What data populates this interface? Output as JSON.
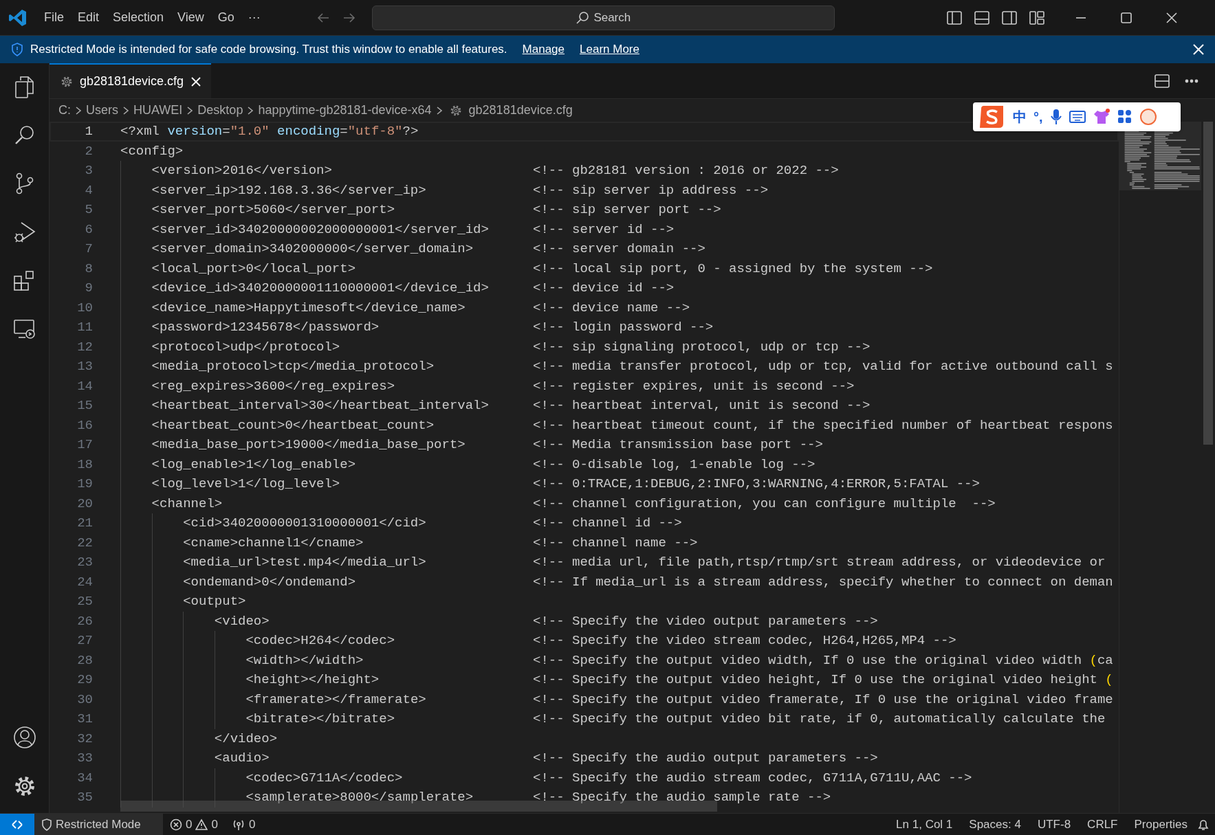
{
  "title_bar": {
    "menus": [
      "File",
      "Edit",
      "Selection",
      "View",
      "Go",
      "···"
    ],
    "search": {
      "placeholder": "Search"
    }
  },
  "banner": {
    "message": "Restricted Mode is intended for safe code browsing. Trust this window to enable all features.",
    "links": [
      "Manage",
      "Learn More"
    ]
  },
  "tabs": [
    {
      "label": "gb28181device.cfg",
      "selected": true
    }
  ],
  "breadcrumbs": [
    "C:",
    "Users",
    "HUAWEI",
    "Desktop",
    "happytime-gb28181-device-x64",
    "gb28181device.cfg"
  ],
  "ime_toolbar": {
    "labels": [
      "中",
      "°,"
    ]
  },
  "editor": {
    "lines": [
      {
        "number": "1",
        "current": true,
        "code": [
          {
            "text": "<?xml ",
            "kind": "plain"
          },
          {
            "text": "version",
            "kind": "attribute"
          },
          {
            "text": "=",
            "kind": "plain"
          },
          {
            "text": "\"1.0\"",
            "kind": "string"
          },
          {
            "text": " encoding",
            "kind": "attribute"
          },
          {
            "text": "=",
            "kind": "plain"
          },
          {
            "text": "\"utf-8\"",
            "kind": "string"
          },
          {
            "text": "?>",
            "kind": "plain"
          }
        ]
      },
      {
        "number": "2",
        "current": false,
        "code": "<config>"
      },
      {
        "number": "3",
        "current": false,
        "code": "    <version>2016</version>",
        "comment": "<!-- gb28181 version : 2016 or 2022 -->"
      },
      {
        "number": "4",
        "current": false,
        "code": "    <server_ip>192.168.3.36</server_ip>",
        "comment": "<!-- sip server ip address -->"
      },
      {
        "number": "5",
        "current": false,
        "code": "    <server_port>5060</server_port>",
        "comment": "<!-- sip server port -->"
      },
      {
        "number": "6",
        "current": false,
        "code": "    <server_id>34020000002000000001</server_id>",
        "comment": "<!-- server id -->"
      },
      {
        "number": "7",
        "current": false,
        "code": "    <server_domain>3402000000</server_domain>",
        "comment": "<!-- server domain -->"
      },
      {
        "number": "8",
        "current": false,
        "code": "    <local_port>0</local_port>",
        "comment": "<!-- local sip port, 0 - assigned by the system -->"
      },
      {
        "number": "9",
        "current": false,
        "code": "    <device_id>34020000001110000001</device_id>",
        "comment": "<!-- device id -->"
      },
      {
        "number": "10",
        "current": false,
        "code": "    <device_name>Happytimesoft</device_name>",
        "comment": "<!-- device name -->"
      },
      {
        "number": "11",
        "current": false,
        "code": "    <password>12345678</password>",
        "comment": "<!-- login password -->"
      },
      {
        "number": "12",
        "current": false,
        "code": "    <protocol>udp</protocol>",
        "comment": "<!-- sip signaling protocol, udp or tcp -->"
      },
      {
        "number": "13",
        "current": false,
        "code": "    <media_protocol>tcp</media_protocol>",
        "comment": "<!-- media transfer protocol, udp or tcp, valid for active outbound call s"
      },
      {
        "number": "14",
        "current": false,
        "code": "    <reg_expires>3600</reg_expires>",
        "comment": "<!-- register expires, unit is second -->"
      },
      {
        "number": "15",
        "current": false,
        "code": "    <heartbeat_interval>30</heartbeat_interval>",
        "comment": "<!-- heartbeat interval, unit is second -->"
      },
      {
        "number": "16",
        "current": false,
        "code": "    <heartbeat_count>0</heartbeat_count>",
        "comment": "<!-- heartbeat timeout count, if the specified number of heartbeat respons"
      },
      {
        "number": "17",
        "current": false,
        "code": "    <media_base_port>19000</media_base_port>",
        "comment": "<!-- Media transmission base port -->"
      },
      {
        "number": "18",
        "current": false,
        "code": "    <log_enable>1</log_enable>",
        "comment": "<!-- 0-disable log, 1-enable log -->"
      },
      {
        "number": "19",
        "current": false,
        "code": "    <log_level>1</log_level>",
        "comment": "<!-- 0:TRACE,1:DEBUG,2:INFO,3:WARNING,4:ERROR,5:FATAL -->"
      },
      {
        "number": "20",
        "current": false,
        "code": "    <channel>",
        "comment": "<!-- channel configuration, you can configure multiple  -->"
      },
      {
        "number": "21",
        "current": false,
        "code": "        <cid>34020000001310000001</cid>",
        "comment": "<!-- channel id -->"
      },
      {
        "number": "22",
        "current": false,
        "code": "        <cname>channel1</cname>",
        "comment": "<!-- channel name -->"
      },
      {
        "number": "23",
        "current": false,
        "code": "        <media_url>test.mp4</media_url>",
        "comment": "<!-- media url, file path,rtsp/rtmp/srt stream address, or videodevice or"
      },
      {
        "number": "24",
        "current": false,
        "code": "        <ondemand>0</ondemand>",
        "comment": "<!-- If media_url is a stream address, specify whether to connect on deman"
      },
      {
        "number": "25",
        "current": false,
        "code": "        <output>"
      },
      {
        "number": "26",
        "current": false,
        "code": "            <video>",
        "comment": "<!-- Specify the video output parameters -->"
      },
      {
        "number": "27",
        "current": false,
        "code": "                <codec>H264</codec>",
        "comment": "<!-- Specify the video stream codec, H264,H265,MP4 -->"
      },
      {
        "number": "28",
        "current": false,
        "code": "                <width></width>",
        "comment": [
          {
            "text": "<!-- Specify the output video width, If 0 use the original video width ",
            "kind": "plain"
          },
          {
            "text": "(",
            "kind": "bracket"
          },
          {
            "text": "ca",
            "kind": "plain"
          }
        ]
      },
      {
        "number": "29",
        "current": false,
        "code": "                <height></height>",
        "comment": [
          {
            "text": "<!-- Specify the output video height, If 0 use the original video height ",
            "kind": "plain"
          },
          {
            "text": "(",
            "kind": "bracket"
          }
        ]
      },
      {
        "number": "30",
        "current": false,
        "code": "                <framerate></framerate>",
        "comment": "<!-- Specify the output video framerate, If 0 use the original video frame"
      },
      {
        "number": "31",
        "current": false,
        "code": "                <bitrate></bitrate>",
        "comment": "<!-- Specify the output video bit rate, if 0, automatically calculate the"
      },
      {
        "number": "32",
        "current": false,
        "code": "            </video>"
      },
      {
        "number": "33",
        "current": false,
        "code": "            <audio>",
        "comment": "<!-- Specify the audio output parameters -->"
      },
      {
        "number": "34",
        "current": false,
        "code": "                <codec>G711A</codec>",
        "comment": "<!-- Specify the audio stream codec, G711A,G711U,AAC -->"
      },
      {
        "number": "35",
        "current": false,
        "code": "                <samplerate>8000</samplerate>",
        "comment": "<!-- Specify the audio sample rate -->"
      }
    ]
  },
  "status_bar": {
    "mode": "Restricted Mode",
    "errors": "0",
    "warnings": "0",
    "ports": "0",
    "items": [
      "Ln 1, Col 1",
      "Spaces: 4",
      "UTF-8",
      "CRLF",
      "Properties"
    ]
  }
}
